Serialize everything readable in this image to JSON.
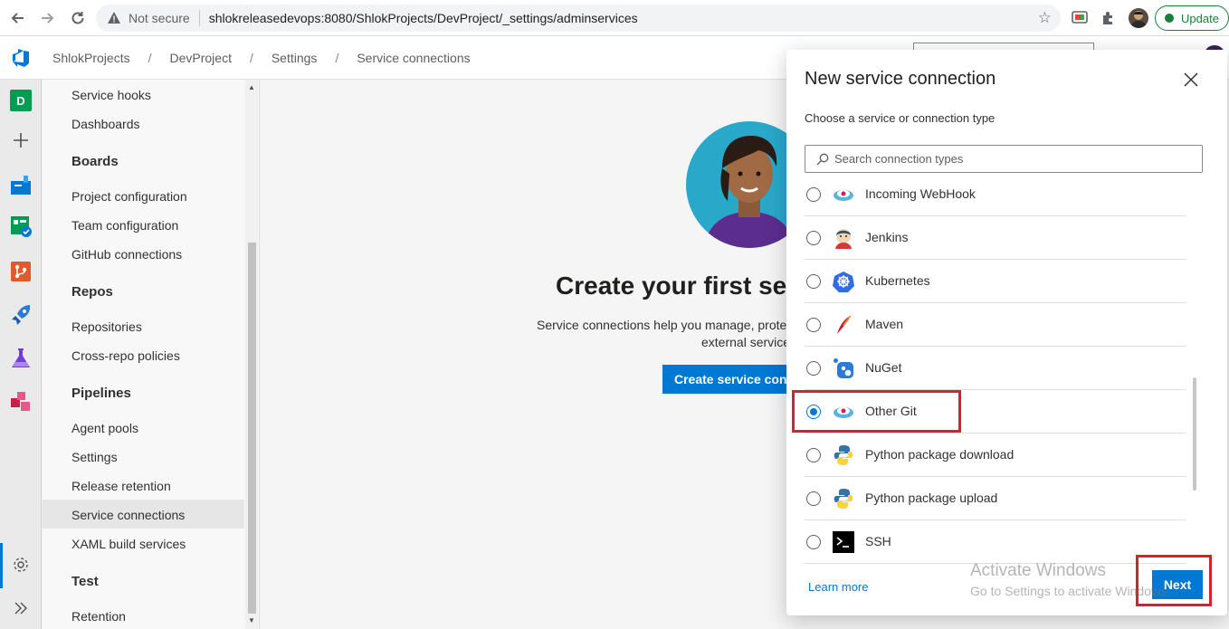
{
  "browser": {
    "not_secure": "Not secure",
    "url": "shlokreleasedevops:8080/ShlokProjects/DevProject/_settings/adminservices",
    "update_label": "Update"
  },
  "header": {
    "breadcrumbs": [
      "ShlokProjects",
      "DevProject",
      "Settings",
      "Service connections"
    ],
    "separator": "/"
  },
  "rail": {
    "project_badge": "D"
  },
  "settings_nav": {
    "items": [
      {
        "label": "Service hooks",
        "type": "item"
      },
      {
        "label": "Dashboards",
        "type": "item"
      },
      {
        "label": "Boards",
        "type": "heading"
      },
      {
        "label": "Project configuration",
        "type": "item"
      },
      {
        "label": "Team configuration",
        "type": "item"
      },
      {
        "label": "GitHub connections",
        "type": "item"
      },
      {
        "label": "Repos",
        "type": "heading"
      },
      {
        "label": "Repositories",
        "type": "item"
      },
      {
        "label": "Cross-repo policies",
        "type": "item"
      },
      {
        "label": "Pipelines",
        "type": "heading"
      },
      {
        "label": "Agent pools",
        "type": "item"
      },
      {
        "label": "Settings",
        "type": "item"
      },
      {
        "label": "Release retention",
        "type": "item"
      },
      {
        "label": "Service connections",
        "type": "item",
        "selected": true
      },
      {
        "label": "XAML build services",
        "type": "item"
      },
      {
        "label": "Test",
        "type": "heading"
      },
      {
        "label": "Retention",
        "type": "item"
      }
    ]
  },
  "main": {
    "title": "Create your first servi",
    "desc_line1": "Service connections help you manage, protec",
    "desc_line2": "external service",
    "create_button": "Create service conn"
  },
  "panel": {
    "title": "New service connection",
    "subtitle": "Choose a service or connection type",
    "search_placeholder": "Search connection types",
    "connection_types": [
      {
        "label": "Incoming WebHook",
        "icon": "webhook-icon",
        "selected": false
      },
      {
        "label": "Jenkins",
        "icon": "jenkins-icon",
        "selected": false
      },
      {
        "label": "Kubernetes",
        "icon": "kubernetes-icon",
        "selected": false
      },
      {
        "label": "Maven",
        "icon": "maven-icon",
        "selected": false
      },
      {
        "label": "NuGet",
        "icon": "nuget-icon",
        "selected": false
      },
      {
        "label": "Other Git",
        "icon": "other-git-icon",
        "selected": true
      },
      {
        "label": "Python package download",
        "icon": "python-icon",
        "selected": false
      },
      {
        "label": "Python package upload",
        "icon": "python-icon",
        "selected": false
      },
      {
        "label": "SSH",
        "icon": "terminal-icon",
        "selected": false
      }
    ],
    "learn_more": "Learn more",
    "next_button": "Next"
  },
  "watermark": {
    "line1": "Activate Windows",
    "line2": "Go to Settings to activate Windows."
  },
  "colors": {
    "accent": "#0078d4",
    "highlight": "#d9202b",
    "rail_bg": "#eaeaea"
  }
}
